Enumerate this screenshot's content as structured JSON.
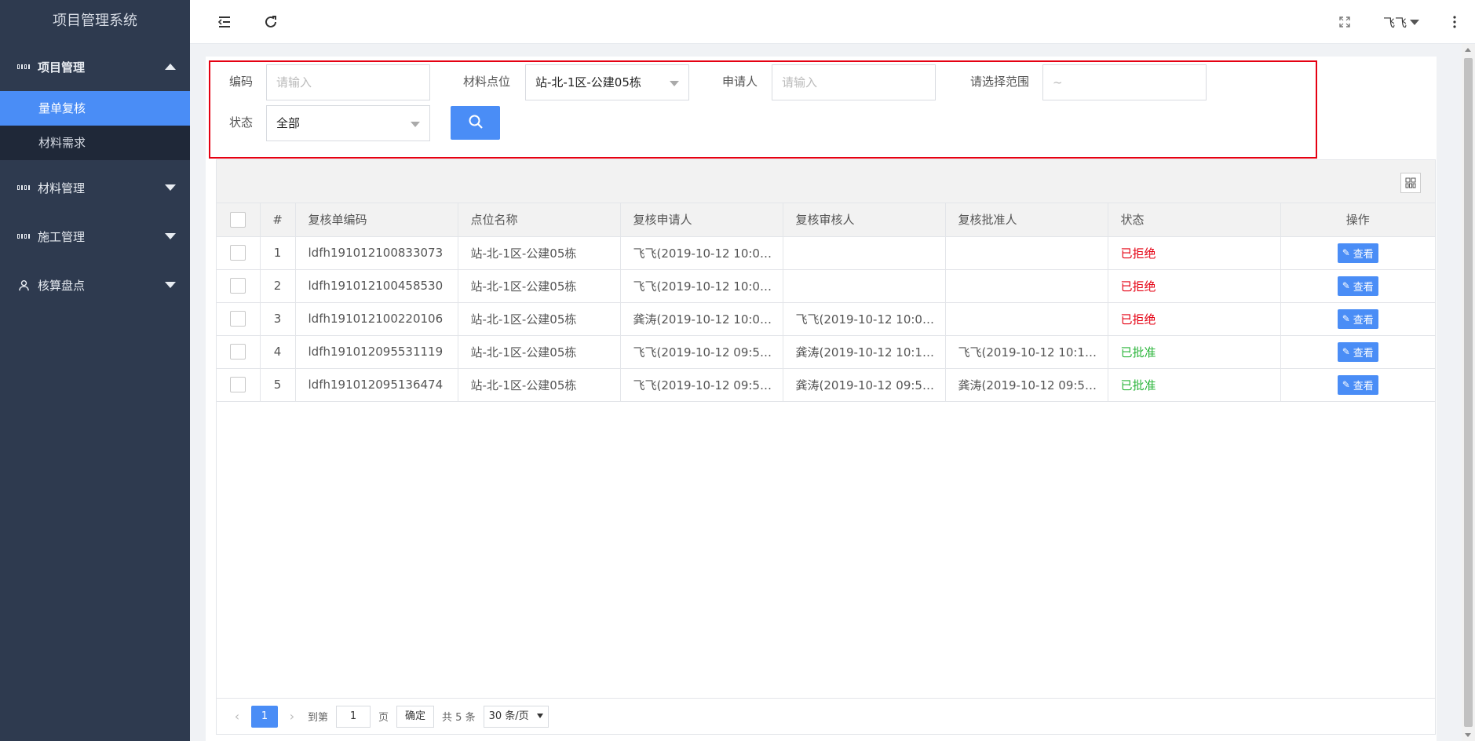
{
  "app": {
    "title": "项目管理系统"
  },
  "sidebar": {
    "groups": [
      {
        "label": "项目管理",
        "icon": "grid-icon",
        "expanded": true,
        "items": [
          {
            "label": "量单复核",
            "active": true
          },
          {
            "label": "材料需求",
            "active": false
          }
        ]
      },
      {
        "label": "材料管理",
        "icon": "grid-icon",
        "expanded": false
      },
      {
        "label": "施工管理",
        "icon": "grid-icon",
        "expanded": false
      },
      {
        "label": "核算盘点",
        "icon": "user-icon",
        "expanded": false
      }
    ]
  },
  "header": {
    "user": "飞飞"
  },
  "filter": {
    "code_label": "编码",
    "code_placeholder": "请输入",
    "location_label": "材料点位",
    "location_value": "站-北-1区-公建05栋",
    "applicant_label": "申请人",
    "applicant_placeholder": "请输入",
    "range_label": "请选择范围",
    "range_placeholder": "~",
    "status_label": "状态",
    "status_value": "全部"
  },
  "table": {
    "headers": [
      "#",
      "复核单编码",
      "点位名称",
      "复核申请人",
      "复核审核人",
      "复核批准人",
      "状态",
      "操作"
    ],
    "view_label": "查看",
    "rows": [
      {
        "no": "1",
        "code": "ldfh191012100833073",
        "location": "站-北-1区-公建05栋",
        "applicant": "飞飞(2019-10-12 10:0…",
        "reviewer": "",
        "approver": "",
        "status": "已拒绝",
        "status_type": "rejected"
      },
      {
        "no": "2",
        "code": "ldfh191012100458530",
        "location": "站-北-1区-公建05栋",
        "applicant": "飞飞(2019-10-12 10:0…",
        "reviewer": "",
        "approver": "",
        "status": "已拒绝",
        "status_type": "rejected"
      },
      {
        "no": "3",
        "code": "ldfh191012100220106",
        "location": "站-北-1区-公建05栋",
        "applicant": "龚涛(2019-10-12 10:0…",
        "reviewer": "飞飞(2019-10-12 10:0…",
        "approver": "",
        "status": "已拒绝",
        "status_type": "rejected"
      },
      {
        "no": "4",
        "code": "ldfh191012095531119",
        "location": "站-北-1区-公建05栋",
        "applicant": "飞飞(2019-10-12 09:5…",
        "reviewer": "龚涛(2019-10-12 10:1…",
        "approver": "飞飞(2019-10-12 10:1…",
        "status": "已批准",
        "status_type": "approved"
      },
      {
        "no": "5",
        "code": "ldfh191012095136474",
        "location": "站-北-1区-公建05栋",
        "applicant": "飞飞(2019-10-12 09:5…",
        "reviewer": "龚涛(2019-10-12 09:5…",
        "approver": "龚涛(2019-10-12 09:5…",
        "status": "已批准",
        "status_type": "approved"
      }
    ]
  },
  "pager": {
    "current_page": "1",
    "goto_label": "到第",
    "goto_value": "1",
    "page_unit": "页",
    "confirm_label": "确定",
    "total_label": "共 5 条",
    "page_size_label": "30 条/页"
  },
  "colors": {
    "accent": "#4a8df6",
    "sidebar_bg": "#2e3a4f",
    "rejected": "#e50012",
    "approved": "#2bb53b",
    "highlight_border": "#e50012"
  }
}
